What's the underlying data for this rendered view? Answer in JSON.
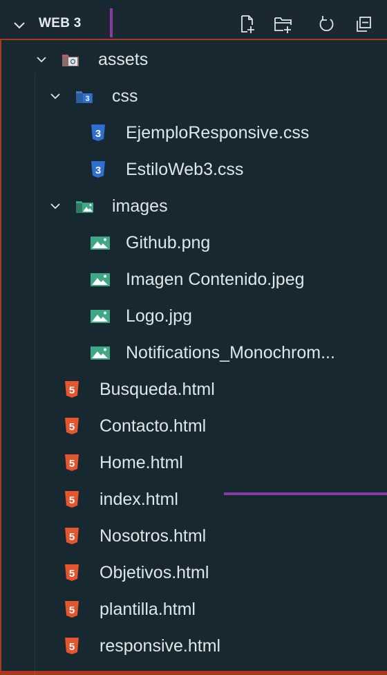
{
  "explorer": {
    "workspace_title": "WEB 3"
  },
  "tree": {
    "assets": {
      "label": "assets",
      "icon": "folder-assets-icon"
    },
    "css": {
      "label": "css",
      "icon": "folder-css-icon"
    },
    "css_files": [
      {
        "label": "EjemploResponsive.css",
        "icon": "css-file-icon"
      },
      {
        "label": "EstiloWeb3.css",
        "icon": "css-file-icon"
      }
    ],
    "images": {
      "label": "images",
      "icon": "folder-images-icon"
    },
    "image_files": [
      {
        "label": "Github.png",
        "icon": "image-file-icon"
      },
      {
        "label": "Imagen Contenido.jpeg",
        "icon": "image-file-icon"
      },
      {
        "label": "Logo.jpg",
        "icon": "image-file-icon"
      },
      {
        "label": "Notifications_Monochrom...",
        "icon": "image-file-icon"
      }
    ],
    "html_files": [
      {
        "label": "Busqueda.html",
        "icon": "html-file-icon"
      },
      {
        "label": "Contacto.html",
        "icon": "html-file-icon"
      },
      {
        "label": "Home.html",
        "icon": "html-file-icon"
      },
      {
        "label": "index.html",
        "icon": "html-file-icon"
      },
      {
        "label": "Nosotros.html",
        "icon": "html-file-icon"
      },
      {
        "label": "Objetivos.html",
        "icon": "html-file-icon"
      },
      {
        "label": "plantilla.html",
        "icon": "html-file-icon"
      },
      {
        "label": "responsive.html",
        "icon": "html-file-icon"
      }
    ]
  },
  "colors": {
    "frame": "#a93a1f",
    "panel": "#182830",
    "accent": "#8a3aa3",
    "css_icon": "#2f6fd1",
    "html_icon": "#e5562e",
    "image_icon": "#3fa885"
  }
}
